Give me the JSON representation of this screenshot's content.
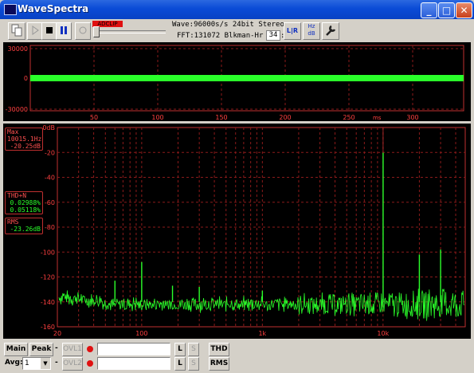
{
  "window": {
    "title": "WaveSpectra",
    "controls": [
      "_",
      "□",
      "✕"
    ]
  },
  "toolbar": {
    "clip_indicator": "ADCLIP",
    "wave_info": "Wave:96000s/s 24bit Stereo",
    "fft_info": "FFT:131072 Blkman-Hr fps:",
    "fps_value": "34",
    "lr_label": "L|R",
    "hz_db_label": "Hz dB"
  },
  "wave_panel": {
    "y_labels": [
      "30000",
      "0",
      "-30000"
    ],
    "x_labels": [
      "50",
      "100",
      "150",
      "200",
      "250",
      "300"
    ],
    "x_unit": "ms"
  },
  "spectrum_panel": {
    "y_labels": [
      "0dB",
      "-20",
      "-40",
      "-60",
      "-80",
      "-100",
      "-120",
      "-140",
      "-160"
    ],
    "x_labels": [
      "20",
      "100",
      "1k",
      "10k"
    ],
    "max_title": "Max",
    "max_freq": "10015.1Hz",
    "max_level": "-20.25dB",
    "thd_title": "THD+N",
    "thd_value1": "0.02988%",
    "thd_value2": "0.05118%",
    "rms_title": "RMS",
    "rms_value": "-23.26dB"
  },
  "bottom": {
    "main_label": "Main",
    "peak_label": "Peak",
    "dash": "-",
    "ovl1_label": "OVL1",
    "ovl2_label": "OVL2",
    "avg_label": "Avg:",
    "avg_value": "1",
    "l_label": "L",
    "s_label": "S",
    "thd_button": "THD",
    "rms_button": "RMS"
  },
  "colors": {
    "trace": "#2aff2a",
    "grid": "#8b1a1a",
    "frame": "#c03030",
    "axis_text": "#ff4040"
  }
}
